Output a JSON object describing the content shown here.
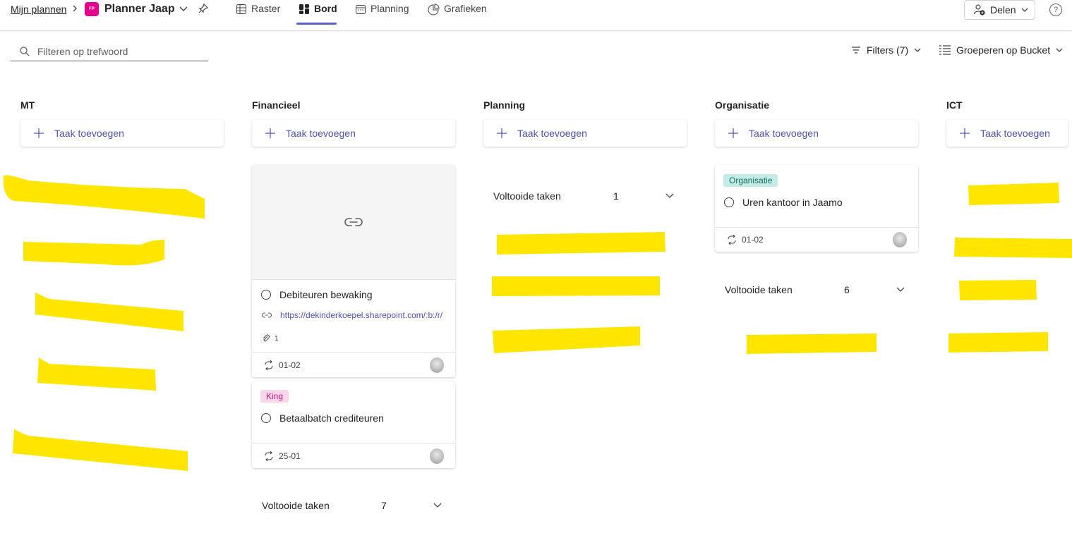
{
  "breadcrumb": {
    "root": "Mijn plannen"
  },
  "plan": {
    "logo_text": "FP",
    "title": "Planner Jaap"
  },
  "tabs": [
    {
      "label": "Raster",
      "icon": "grid-icon"
    },
    {
      "label": "Bord",
      "icon": "board-icon",
      "active": true
    },
    {
      "label": "Planning",
      "icon": "calendar-icon"
    },
    {
      "label": "Grafieken",
      "icon": "chart-icon"
    }
  ],
  "share": {
    "label": "Delen"
  },
  "help": {
    "label": "?"
  },
  "toolbar": {
    "search_placeholder": "Filteren op trefwoord",
    "filters_label": "Filters (7)",
    "group_label": "Groeperen op Bucket"
  },
  "add_task_label": "Taak toevoegen",
  "completed_label": "Voltooide taken",
  "buckets": [
    {
      "name": "MT"
    },
    {
      "name": "Financieel",
      "completed_count": "7",
      "cards": [
        {
          "title": "Debiteuren bewaking",
          "link": "https://dekinderkoepel.sharepoint.com/:b:/r/",
          "attachments": "1",
          "date": "01-02"
        },
        {
          "label": "King",
          "title": "Betaalbatch crediteuren",
          "date": "25-01"
        }
      ]
    },
    {
      "name": "Planning",
      "completed_count": "1"
    },
    {
      "name": "Organisatie",
      "completed_count": "6",
      "cards": [
        {
          "label": "Organisatie",
          "title": "Uren kantoor in Jaamo",
          "date": "01-02"
        }
      ]
    },
    {
      "name": "ICT"
    }
  ],
  "colors": {
    "accent": "#5b5fc7",
    "add_task_text": "#4f52b2",
    "plan_logo": "#e3008c",
    "label_king_bg": "#fbd5ea",
    "label_king_text": "#b0207a",
    "label_org_bg": "#c5ebe6",
    "label_org_text": "#0b6a61",
    "highlight": "#ffe600"
  }
}
